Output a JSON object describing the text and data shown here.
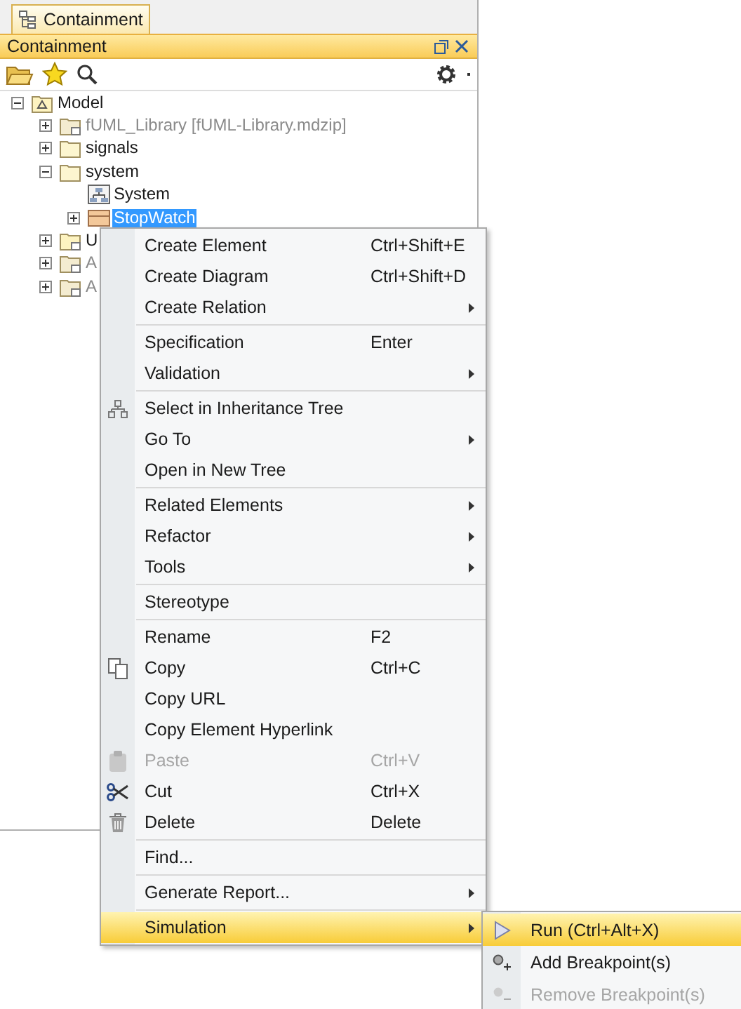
{
  "tab": {
    "label": "Containment",
    "selected": true
  },
  "panel": {
    "title": "Containment"
  },
  "tree": [
    {
      "label": "Model",
      "kind": "model",
      "expanded": true,
      "selected": false,
      "disabled": false,
      "children": [
        {
          "label": "fUML_Library [fUML-Library.mdzip]",
          "kind": "library",
          "expanded": false,
          "selected": false,
          "disabled": true
        },
        {
          "label": "signals",
          "kind": "folder",
          "expanded": false,
          "selected": false,
          "disabled": false
        },
        {
          "label": "system",
          "kind": "folder",
          "expanded": true,
          "selected": false,
          "disabled": false,
          "children": [
            {
              "label": "System",
              "kind": "diagram",
              "selected": false,
              "disabled": false
            },
            {
              "label": "StopWatch",
              "kind": "block",
              "expanded": false,
              "selected": true,
              "disabled": false
            }
          ]
        },
        {
          "label": "U",
          "kind": "library",
          "expanded": false,
          "selected": false,
          "disabled": false
        },
        {
          "label": "A",
          "kind": "profile",
          "expanded": false,
          "selected": false,
          "disabled": true
        },
        {
          "label": "A",
          "kind": "model-library",
          "expanded": false,
          "selected": false,
          "disabled": true
        }
      ]
    }
  ],
  "context_menu": {
    "items": [
      {
        "kind": "item",
        "label": "Create Element",
        "shortcut": "Ctrl+Shift+E",
        "submenu": false,
        "disabled": false,
        "selected": false
      },
      {
        "kind": "item",
        "label": "Create Diagram",
        "shortcut": "Ctrl+Shift+D",
        "submenu": false,
        "disabled": false,
        "selected": false
      },
      {
        "kind": "item",
        "label": "Create Relation",
        "submenu": true,
        "disabled": false,
        "selected": false
      },
      {
        "kind": "separator"
      },
      {
        "kind": "item",
        "label": "Specification",
        "shortcut": "Enter",
        "submenu": false,
        "disabled": false,
        "selected": false
      },
      {
        "kind": "item",
        "label": "Validation",
        "submenu": true,
        "disabled": false,
        "selected": false
      },
      {
        "kind": "separator"
      },
      {
        "kind": "item",
        "label": "Select in Inheritance Tree",
        "submenu": false,
        "disabled": false,
        "selected": false
      },
      {
        "kind": "item",
        "label": "Go To",
        "submenu": true,
        "disabled": false,
        "selected": false
      },
      {
        "kind": "item",
        "label": "Open in New Tree",
        "submenu": false,
        "disabled": false,
        "selected": false
      },
      {
        "kind": "separator"
      },
      {
        "kind": "item",
        "label": "Related Elements",
        "submenu": true,
        "disabled": false,
        "selected": false
      },
      {
        "kind": "item",
        "label": "Refactor",
        "submenu": true,
        "disabled": false,
        "selected": false
      },
      {
        "kind": "item",
        "label": "Tools",
        "submenu": true,
        "disabled": false,
        "selected": false
      },
      {
        "kind": "separator"
      },
      {
        "kind": "item",
        "label": "Stereotype",
        "submenu": false,
        "disabled": false,
        "selected": false
      },
      {
        "kind": "separator"
      },
      {
        "kind": "item",
        "label": "Rename",
        "shortcut": "F2",
        "submenu": false,
        "disabled": false,
        "selected": false
      },
      {
        "kind": "item",
        "label": "Copy",
        "shortcut": "Ctrl+C",
        "submenu": false,
        "disabled": false,
        "selected": false
      },
      {
        "kind": "item",
        "label": "Copy URL",
        "submenu": false,
        "disabled": false,
        "selected": false
      },
      {
        "kind": "item",
        "label": "Copy Element Hyperlink",
        "submenu": false,
        "disabled": false,
        "selected": false
      },
      {
        "kind": "item",
        "label": "Paste",
        "shortcut": "Ctrl+V",
        "submenu": false,
        "disabled": true,
        "selected": false
      },
      {
        "kind": "item",
        "label": "Cut",
        "shortcut": "Ctrl+X",
        "submenu": false,
        "disabled": false,
        "selected": false
      },
      {
        "kind": "item",
        "label": "Delete",
        "shortcut": "Delete",
        "submenu": false,
        "disabled": false,
        "selected": false
      },
      {
        "kind": "separator"
      },
      {
        "kind": "item",
        "label": "Find...",
        "submenu": false,
        "disabled": false,
        "selected": false
      },
      {
        "kind": "separator"
      },
      {
        "kind": "item",
        "label": "Generate Report...",
        "submenu": true,
        "disabled": false,
        "selected": false
      },
      {
        "kind": "separator"
      },
      {
        "kind": "item",
        "label": "Simulation",
        "submenu": true,
        "disabled": false,
        "selected": true
      }
    ]
  },
  "submenu": {
    "items": [
      {
        "label": "Run (Ctrl+Alt+X)",
        "disabled": false,
        "selected": true
      },
      {
        "label": "Add Breakpoint(s)",
        "disabled": false,
        "selected": false
      },
      {
        "label": "Remove Breakpoint(s)",
        "disabled": true,
        "selected": false
      }
    ]
  }
}
